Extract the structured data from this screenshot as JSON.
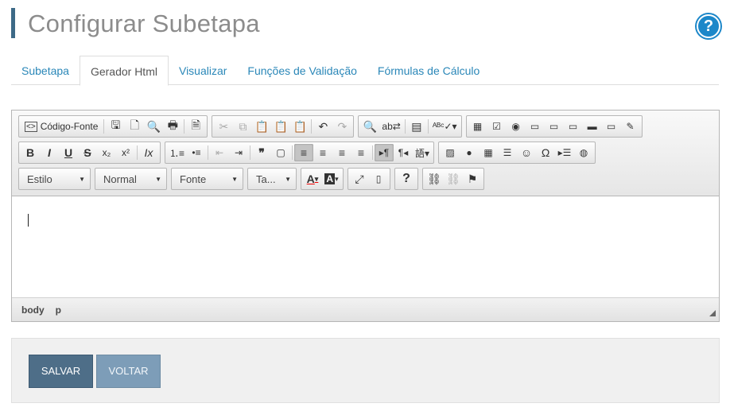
{
  "header": {
    "title": "Configurar Subetapa",
    "help_label": "?"
  },
  "tabs": [
    {
      "label": "Subetapa"
    },
    {
      "label": "Gerador Html"
    },
    {
      "label": "Visualizar"
    },
    {
      "label": "Funções de Validação"
    },
    {
      "label": "Fórmulas de Cálculo"
    }
  ],
  "active_tab": "Gerador Html",
  "editor": {
    "toolbar": {
      "source_label": "Código-Fonte",
      "format_button_labels": {
        "bold": "B",
        "italic": "I",
        "underline": "U",
        "strike": "S",
        "help": "?",
        "font_color": "A",
        "bg_color": "A"
      },
      "combos": {
        "style": "Estilo",
        "format": "Normal",
        "font": "Fonte",
        "size": "Ta..."
      }
    },
    "status": {
      "path": [
        "body",
        "p"
      ]
    }
  },
  "actions": {
    "save_label": "SALVAR",
    "back_label": "VOLTAR"
  },
  "colors": {
    "accent": "#3d6a87",
    "link": "#2a87b8",
    "help": "#1c87c9",
    "save": "#4e6e88",
    "back": "#7d9db8"
  }
}
